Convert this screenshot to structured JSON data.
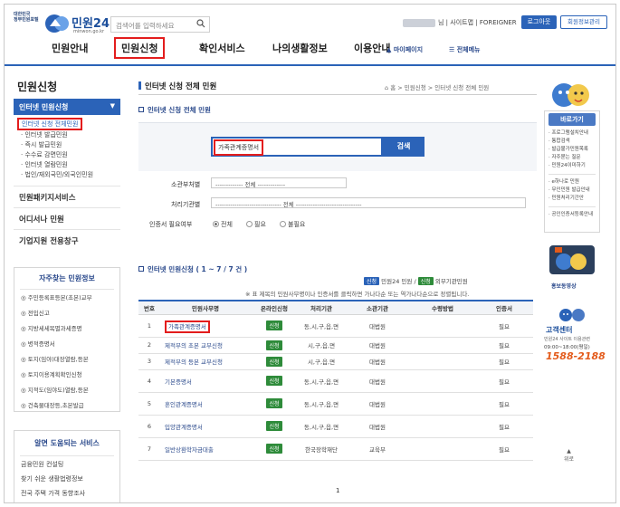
{
  "header": {
    "emblem_lines": [
      "대한민국",
      "정부민원포털"
    ],
    "logo_text": "민원24",
    "logo_sub": "minwon.go.kr",
    "search_placeholder": "검색어를 입력하세요",
    "user_suffix": "님 | 사이트맵 | FOREIGNER",
    "logout_label": "로그아웃",
    "member_label": "회원정보관리",
    "mypage_label": "마이페이지",
    "allmenu_label": "전체메뉴",
    "nav": [
      "민원안내",
      "민원신청",
      "확인서비스",
      "나의생활정보",
      "이용안내"
    ],
    "nav_active_index": 1
  },
  "sidebar": {
    "title": "민원신청",
    "selected": "인터넷 민원신청",
    "subitems": [
      "인터넷 신청 전체민원",
      "인터넷 발급민원",
      "즉시 발급민원",
      "수수료 감면민원",
      "인터넷 열람민원",
      "법인/재외국민/외국인민원"
    ],
    "subitem_active_index": 0,
    "items": [
      "민원패키지서비스",
      "어디서나 민원",
      "기업지원 전용창구"
    ],
    "freq_title": "자주찾는 민원정보",
    "freq_items": [
      "주민등록표등본(초본)교부",
      "전입신고",
      "지방세세목별과세증명",
      "병적증명서",
      "토지(임야)대장열람,등본",
      "토지이용계획확인신청",
      "지적도(임야도)열람,등본",
      "건축물대장등,초본발급"
    ],
    "help_title": "알면 도움되는 서비스",
    "help_items": [
      "금융민원 컨설팅",
      "찾기 쉬운 생활법령정보",
      "전국 주택 가격 동향조사"
    ]
  },
  "main": {
    "page_title": "인터넷 신청 전체 민원",
    "breadcrumb": "홈 > 민원신청 > 인터넷 신청 전체 민원",
    "search_section_title": "인터넷 신청 전체 민원",
    "search_value": "가족관계증명서",
    "search_button": "검색",
    "dept_label": "소관부처별",
    "dept_select": "------------- 전체 -------------",
    "org_label": "처리기관별",
    "org_select": "------------------------------- 전체 -------------------------------",
    "cert_label": "인증서 필요여부",
    "cert_options": [
      "전체",
      "필요",
      "불필요"
    ],
    "cert_selected_index": 0,
    "result_title": "인터넷 민원신청 ( 1 ~ 7 / 7 건 )",
    "legend_online": "신청",
    "legend_online_text": "민원24 민원 /",
    "legend_external": "신청",
    "legend_external_text": "외부기관민원",
    "note": "※ 표 제목의 민원사무명이나 인증서를 클릭하면 가나다순 또는 역가나다순으로 정렬됩니다.",
    "table": {
      "headers": [
        "번호",
        "민원사무명",
        "온라인신청",
        "처리기관",
        "소관기관",
        "수령방법",
        "인증서"
      ],
      "rows": [
        {
          "no": "1",
          "name": "가족관계증명서",
          "online": "신청",
          "proc": "동,시,구,읍,면",
          "owner": "대법원",
          "receive": "",
          "cert": "필요",
          "highlight": true
        },
        {
          "no": "2",
          "name": "제적부의 초본 교부신청",
          "online": "신청",
          "proc": "시,구,읍,면",
          "owner": "대법원",
          "receive": "",
          "cert": "필요"
        },
        {
          "no": "3",
          "name": "제적부의 등본 교부신청",
          "online": "신청",
          "proc": "시,구,읍,면",
          "owner": "대법원",
          "receive": "",
          "cert": "필요"
        },
        {
          "no": "4",
          "name": "기본증명서",
          "online": "신청",
          "proc": "동,시,구,읍,면",
          "owner": "대법원",
          "receive": "",
          "cert": "필요"
        },
        {
          "no": "5",
          "name": "혼인관계증명서",
          "online": "신청",
          "proc": "동,시,구,읍,면",
          "owner": "대법원",
          "receive": "",
          "cert": "필요"
        },
        {
          "no": "6",
          "name": "입양관계증명서",
          "online": "신청",
          "proc": "동,시,구,읍,면",
          "owner": "대법원",
          "receive": "",
          "cert": "필요"
        },
        {
          "no": "7",
          "name": "일반상환학자금대출",
          "online": "신청",
          "proc": "한국장학재단",
          "owner": "교육부",
          "receive": "",
          "cert": "필요"
        }
      ]
    },
    "page": "1"
  },
  "right": {
    "head": "바로가기",
    "links1": [
      "프로그램설치안내",
      "통합검색",
      "발급불가민원목록",
      "자주묻는 질문",
      "민원24이미하기"
    ],
    "links2": [
      "e하나로 민원",
      "무인민원 발급안내",
      "민원처리기간안"
    ],
    "links3": [
      "공인인증서등록안내"
    ],
    "promo_label": "홍보동영상",
    "call_title": "고객센터",
    "call_sub": "민원24 사이트 이용관련",
    "call_hours": "09:00~18:00(평일)",
    "call_number": "1588-2188",
    "top_label": "위로"
  },
  "colors": {
    "accent": "#2b63b8",
    "highlight": "#e31d1d",
    "online_tag": "#2e8b3a"
  }
}
